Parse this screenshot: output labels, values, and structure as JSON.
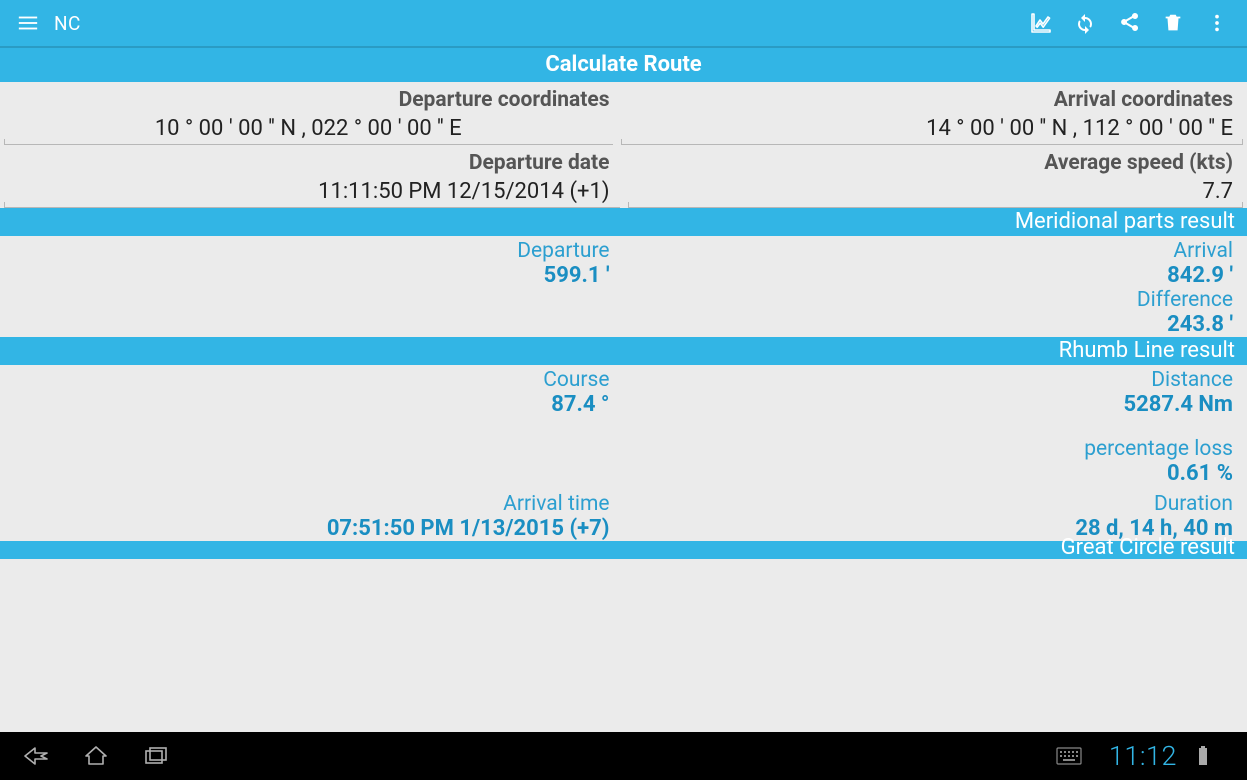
{
  "action_bar": {
    "title": "NC"
  },
  "page_title": "Calculate Route",
  "inputs": {
    "dep_coord_label": "Departure coordinates",
    "arr_coord_label": "Arrival coordinates",
    "dep_coord_value": "10 ° 00 ' 00 '' N  ,  022 ° 00 ' 00 '' E",
    "arr_coord_value": "14 ° 00 ' 00 '' N  ,  112 ° 00 ' 00 '' E",
    "dep_date_label": "Departure date",
    "speed_label": "Average speed (kts)",
    "dep_date_value": "11:11:50 PM 12/15/2014 (+1)",
    "speed_value": "7.7"
  },
  "meridional": {
    "band": "Meridional parts result",
    "dep_label": "Departure",
    "dep_value": "599.1 '",
    "arr_label": "Arrival",
    "arr_value": "842.9 '",
    "diff_label": "Difference",
    "diff_value": "243.8 '"
  },
  "rhumb": {
    "band": "Rhumb Line result",
    "course_label": "Course",
    "course_value": "87.4 °",
    "dist_label": "Distance",
    "dist_value": "5287.4 Nm",
    "pct_label": "percentage loss",
    "pct_value": "0.61 %",
    "arr_time_label": "Arrival time",
    "arr_time_value": "07:51:50 PM 1/13/2015 (+7)",
    "dur_label": "Duration",
    "dur_value": "28 d, 14 h, 40 m"
  },
  "great_circle": {
    "band": "Great Circle result"
  },
  "nav": {
    "clock": "11:12"
  }
}
